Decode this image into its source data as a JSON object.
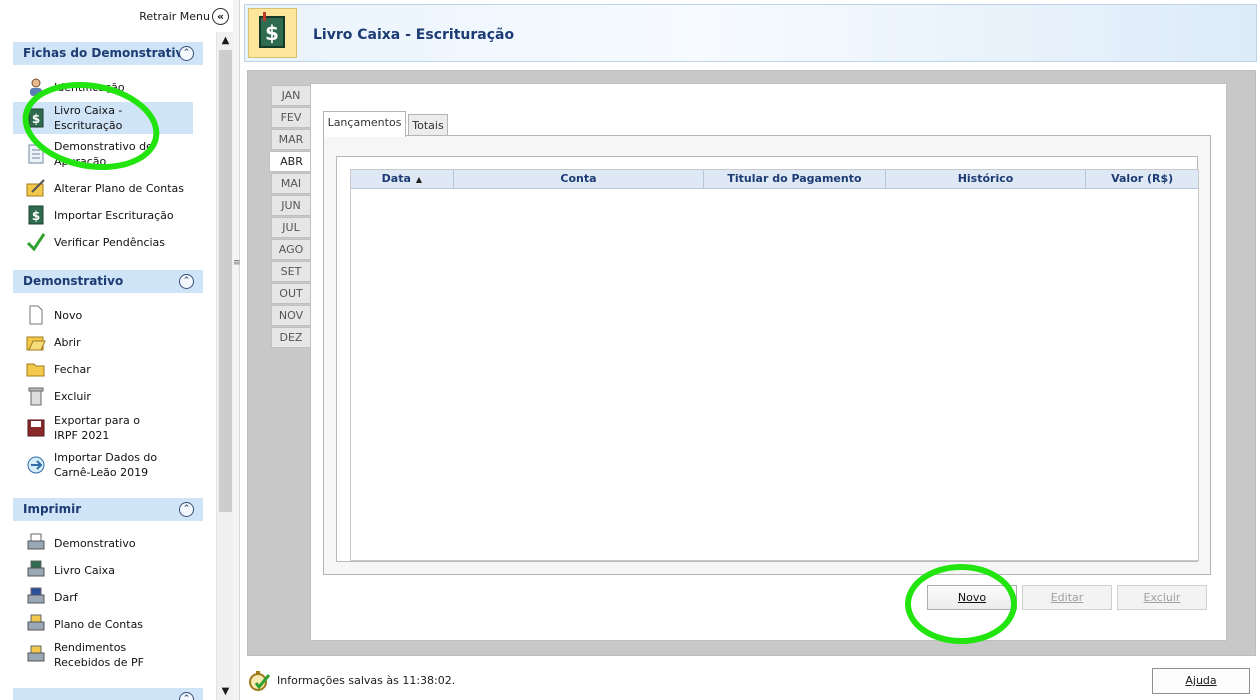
{
  "sidebar": {
    "retract_label": "Retrair Menu",
    "sections": [
      {
        "title": "Fichas do Demonstrativo",
        "items": [
          "Identificação",
          "Livro Caixa - Escrituração",
          "Demonstrativo de Apuração",
          "Alterar Plano de Contas",
          "Importar Escrituração",
          "Verificar Pendências"
        ]
      },
      {
        "title": "Demonstrativo",
        "items": [
          "Novo",
          "Abrir",
          "Fechar",
          "Excluir",
          "Exportar para o IRPF 2021",
          "Importar Dados do Carnê-Leão 2019"
        ]
      },
      {
        "title": "Imprimir",
        "items": [
          "Demonstrativo",
          "Livro Caixa",
          "Darf",
          "Plano de Contas",
          "Rendimentos Recebidos de PF"
        ]
      }
    ]
  },
  "header": {
    "title": "Livro Caixa - Escrituração"
  },
  "months": [
    "JAN",
    "FEV",
    "MAR",
    "ABR",
    "MAI",
    "JUN",
    "JUL",
    "AGO",
    "SET",
    "OUT",
    "NOV",
    "DEZ"
  ],
  "selected_month": "ABR",
  "tabs": [
    "Lançamentos",
    "Totais"
  ],
  "table": {
    "columns": [
      "Data",
      "Conta",
      "Titular do Pagamento",
      "Histórico",
      "Valor (R$)"
    ],
    "rows": []
  },
  "actions": {
    "new": "Novo",
    "edit": "Editar",
    "delete": "Excluir"
  },
  "status": {
    "text": "Informações salvas às 11:38:02.",
    "help": "Ajuda"
  },
  "colors": {
    "highlight": "#22e40f",
    "section_bg": "#cfe4f6",
    "title": "#1d3b74"
  }
}
